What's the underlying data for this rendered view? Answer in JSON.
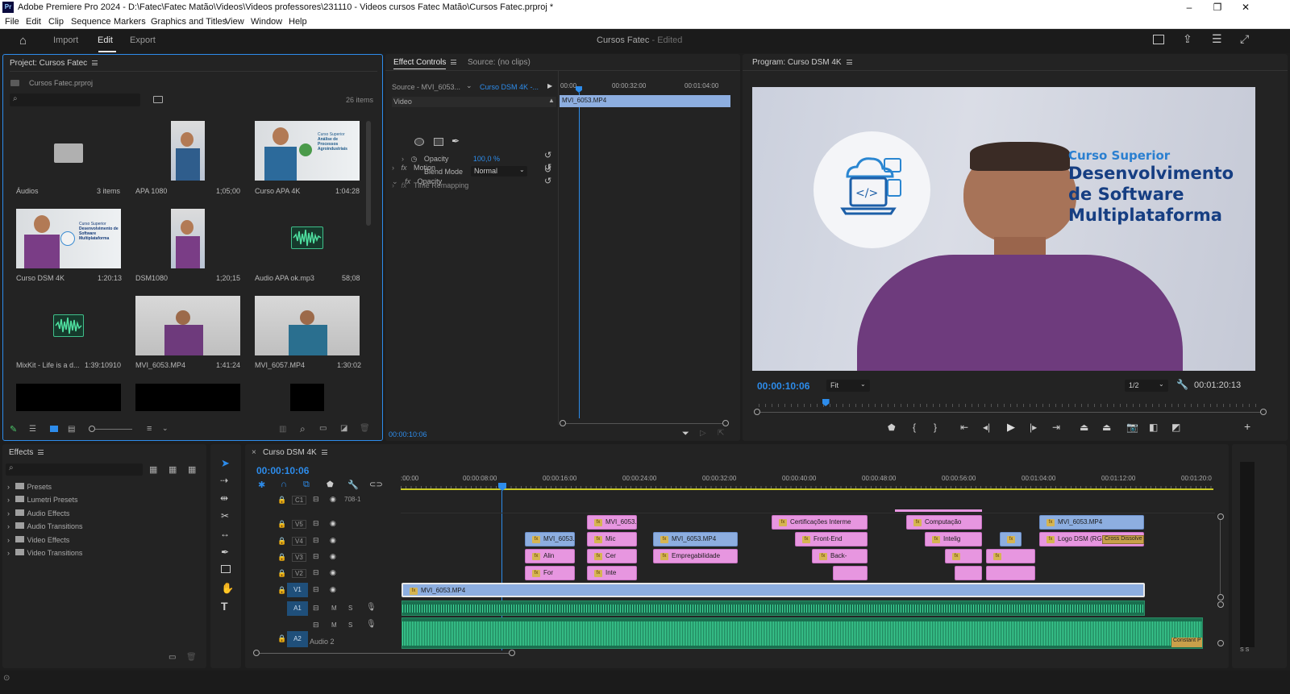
{
  "window": {
    "title": "Adobe Premiere Pro 2024 - D:\\Fatec\\Fatec Matão\\Videos\\Videos professores\\231110 - Videos cursos Fatec Matão\\Cursos Fatec.prproj *",
    "logo": "Pr",
    "minimize": "–",
    "maximize": "❐",
    "close": "✕"
  },
  "menu": [
    "File",
    "Edit",
    "Clip",
    "Sequence",
    "Markers",
    "Graphics and Titles",
    "View",
    "Window",
    "Help"
  ],
  "header": {
    "tabs": [
      "Import",
      "Edit",
      "Export"
    ],
    "project_title": "Cursos Fatec",
    "project_status": "- Edited"
  },
  "project": {
    "tab": "Project: Cursos Fatec",
    "file": "Cursos Fatec.prproj",
    "count": "26 items",
    "items": [
      {
        "name": "Áudios",
        "duration": "3 items"
      },
      {
        "name": "APA 1080",
        "duration": "1;05;00"
      },
      {
        "name": "Curso APA 4K",
        "duration": "1:04:28"
      },
      {
        "name": "Curso DSM 4K",
        "duration": "1:20:13"
      },
      {
        "name": "DSM1080",
        "duration": "1;20;15"
      },
      {
        "name": "Audio APA ok.mp3",
        "duration": "58;08"
      },
      {
        "name": "MixKit - Life is a d...",
        "duration": "1:39:10910"
      },
      {
        "name": "MVI_6053.MP4",
        "duration": "1:41:24"
      },
      {
        "name": "MVI_6057.MP4",
        "duration": "1:30:02"
      }
    ],
    "apa_card": {
      "line1": "Curso Superior",
      "line2": "Análise de Processos Agroindustriais"
    },
    "dsm_card": {
      "line1": "Curso Superior",
      "line2": "Desenvolvimento de Software Multiplataforma"
    }
  },
  "effect_controls": {
    "tab": "Effect Controls",
    "source_tab": "Source: (no clips)",
    "source_label": "Source - MVI_6053...",
    "seq_label": "Curso DSM 4K -...",
    "ruler": [
      "00:00",
      "00:00:32:00",
      "00:01:04:00"
    ],
    "clip_name": "MVI_6053.MP4",
    "video_label": "Video",
    "motion": "Motion",
    "opacity": "Opacity",
    "opacity_prop": "Opacity",
    "opacity_value": "100,0 %",
    "blend_label": "Blend Mode",
    "blend_value": "Normal",
    "time_remap": "Time Remapping",
    "timecode": "00:00:10:06"
  },
  "program": {
    "tab": "Program: Curso DSM 4K",
    "timecode": "00:00:10:06",
    "fit": "Fit",
    "quality": "1/2",
    "duration": "00:01:20:13",
    "overlay": {
      "line1": "Curso Superior",
      "line2": "Desenvolvimento",
      "line3": "de Software",
      "line4": "Multiplataforma"
    },
    "playhead_fraction": 0.13
  },
  "effects": {
    "tab": "Effects",
    "folders": [
      "Presets",
      "Lumetri Presets",
      "Audio Effects",
      "Audio Transitions",
      "Video Effects",
      "Video Transitions"
    ]
  },
  "timeline": {
    "tab": "Curso DSM 4K",
    "timecode": "00:00:10:06",
    "ruler": [
      ":00:00",
      "00:00:08:00",
      "00:00:16:00",
      "00:00:24:00",
      "00:00:32:00",
      "00:00:40:00",
      "00:00:48:00",
      "00:00:56:00",
      "00:01:04:00",
      "00:01:12:00",
      "00:01:20:0"
    ],
    "c1_label": "708-1",
    "tracks": [
      "C1",
      "V5",
      "V4",
      "V3",
      "V2",
      "V1",
      "A1",
      "A2"
    ],
    "audio2_label": "Audio 2",
    "clips": {
      "v5_a": "MVI_6053.",
      "v5_b": "Certificações Interme",
      "v5_c": "Computação",
      "v5_d": "MVI_6053.MP4",
      "v4_a": "MVI_6053.",
      "v4_b": "Mic",
      "v4_c": "MVI_6053.MP4",
      "v4_d": "Front-End",
      "v4_e": "Intelig",
      "v4_f": "Logo DSM (RG",
      "v4_g": "Cross Dissolve",
      "v3_a": "Alin",
      "v3_b": "Cer",
      "v3_c": "Empregabilidade",
      "v3_d": "Back-",
      "v2_a": "For",
      "v2_b": "Inte",
      "v1_a": "MVI_6053.MP4",
      "a2_end": "Constant P"
    },
    "mute": "M",
    "solo": "S"
  }
}
